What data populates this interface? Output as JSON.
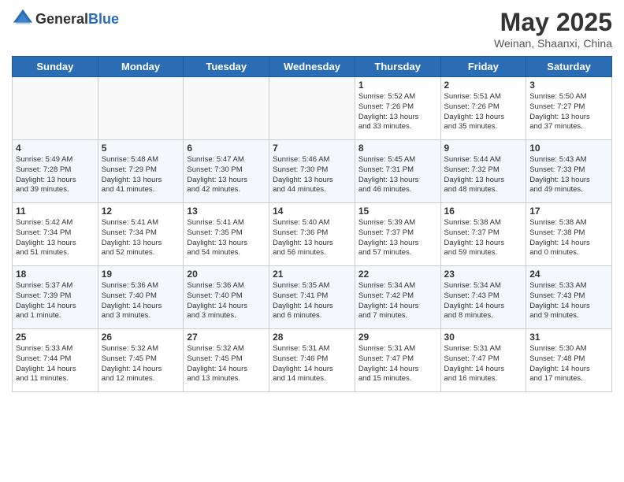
{
  "header": {
    "logo_general": "General",
    "logo_blue": "Blue",
    "title": "May 2025",
    "subtitle": "Weinan, Shaanxi, China"
  },
  "days_of_week": [
    "Sunday",
    "Monday",
    "Tuesday",
    "Wednesday",
    "Thursday",
    "Friday",
    "Saturday"
  ],
  "weeks": [
    [
      {
        "day": "",
        "info": ""
      },
      {
        "day": "",
        "info": ""
      },
      {
        "day": "",
        "info": ""
      },
      {
        "day": "",
        "info": ""
      },
      {
        "day": "1",
        "info": "Sunrise: 5:52 AM\nSunset: 7:26 PM\nDaylight: 13 hours\nand 33 minutes."
      },
      {
        "day": "2",
        "info": "Sunrise: 5:51 AM\nSunset: 7:26 PM\nDaylight: 13 hours\nand 35 minutes."
      },
      {
        "day": "3",
        "info": "Sunrise: 5:50 AM\nSunset: 7:27 PM\nDaylight: 13 hours\nand 37 minutes."
      }
    ],
    [
      {
        "day": "4",
        "info": "Sunrise: 5:49 AM\nSunset: 7:28 PM\nDaylight: 13 hours\nand 39 minutes."
      },
      {
        "day": "5",
        "info": "Sunrise: 5:48 AM\nSunset: 7:29 PM\nDaylight: 13 hours\nand 41 minutes."
      },
      {
        "day": "6",
        "info": "Sunrise: 5:47 AM\nSunset: 7:30 PM\nDaylight: 13 hours\nand 42 minutes."
      },
      {
        "day": "7",
        "info": "Sunrise: 5:46 AM\nSunset: 7:30 PM\nDaylight: 13 hours\nand 44 minutes."
      },
      {
        "day": "8",
        "info": "Sunrise: 5:45 AM\nSunset: 7:31 PM\nDaylight: 13 hours\nand 46 minutes."
      },
      {
        "day": "9",
        "info": "Sunrise: 5:44 AM\nSunset: 7:32 PM\nDaylight: 13 hours\nand 48 minutes."
      },
      {
        "day": "10",
        "info": "Sunrise: 5:43 AM\nSunset: 7:33 PM\nDaylight: 13 hours\nand 49 minutes."
      }
    ],
    [
      {
        "day": "11",
        "info": "Sunrise: 5:42 AM\nSunset: 7:34 PM\nDaylight: 13 hours\nand 51 minutes."
      },
      {
        "day": "12",
        "info": "Sunrise: 5:41 AM\nSunset: 7:34 PM\nDaylight: 13 hours\nand 52 minutes."
      },
      {
        "day": "13",
        "info": "Sunrise: 5:41 AM\nSunset: 7:35 PM\nDaylight: 13 hours\nand 54 minutes."
      },
      {
        "day": "14",
        "info": "Sunrise: 5:40 AM\nSunset: 7:36 PM\nDaylight: 13 hours\nand 56 minutes."
      },
      {
        "day": "15",
        "info": "Sunrise: 5:39 AM\nSunset: 7:37 PM\nDaylight: 13 hours\nand 57 minutes."
      },
      {
        "day": "16",
        "info": "Sunrise: 5:38 AM\nSunset: 7:37 PM\nDaylight: 13 hours\nand 59 minutes."
      },
      {
        "day": "17",
        "info": "Sunrise: 5:38 AM\nSunset: 7:38 PM\nDaylight: 14 hours\nand 0 minutes."
      }
    ],
    [
      {
        "day": "18",
        "info": "Sunrise: 5:37 AM\nSunset: 7:39 PM\nDaylight: 14 hours\nand 1 minute."
      },
      {
        "day": "19",
        "info": "Sunrise: 5:36 AM\nSunset: 7:40 PM\nDaylight: 14 hours\nand 3 minutes."
      },
      {
        "day": "20",
        "info": "Sunrise: 5:36 AM\nSunset: 7:40 PM\nDaylight: 14 hours\nand 3 minutes."
      },
      {
        "day": "21",
        "info": "Sunrise: 5:35 AM\nSunset: 7:41 PM\nDaylight: 14 hours\nand 6 minutes."
      },
      {
        "day": "22",
        "info": "Sunrise: 5:34 AM\nSunset: 7:42 PM\nDaylight: 14 hours\nand 7 minutes."
      },
      {
        "day": "23",
        "info": "Sunrise: 5:34 AM\nSunset: 7:43 PM\nDaylight: 14 hours\nand 8 minutes."
      },
      {
        "day": "24",
        "info": "Sunrise: 5:33 AM\nSunset: 7:43 PM\nDaylight: 14 hours\nand 9 minutes."
      }
    ],
    [
      {
        "day": "25",
        "info": "Sunrise: 5:33 AM\nSunset: 7:44 PM\nDaylight: 14 hours\nand 11 minutes."
      },
      {
        "day": "26",
        "info": "Sunrise: 5:32 AM\nSunset: 7:45 PM\nDaylight: 14 hours\nand 12 minutes."
      },
      {
        "day": "27",
        "info": "Sunrise: 5:32 AM\nSunset: 7:45 PM\nDaylight: 14 hours\nand 13 minutes."
      },
      {
        "day": "28",
        "info": "Sunrise: 5:31 AM\nSunset: 7:46 PM\nDaylight: 14 hours\nand 14 minutes."
      },
      {
        "day": "29",
        "info": "Sunrise: 5:31 AM\nSunset: 7:47 PM\nDaylight: 14 hours\nand 15 minutes."
      },
      {
        "day": "30",
        "info": "Sunrise: 5:31 AM\nSunset: 7:47 PM\nDaylight: 14 hours\nand 16 minutes."
      },
      {
        "day": "31",
        "info": "Sunrise: 5:30 AM\nSunset: 7:48 PM\nDaylight: 14 hours\nand 17 minutes."
      }
    ]
  ]
}
